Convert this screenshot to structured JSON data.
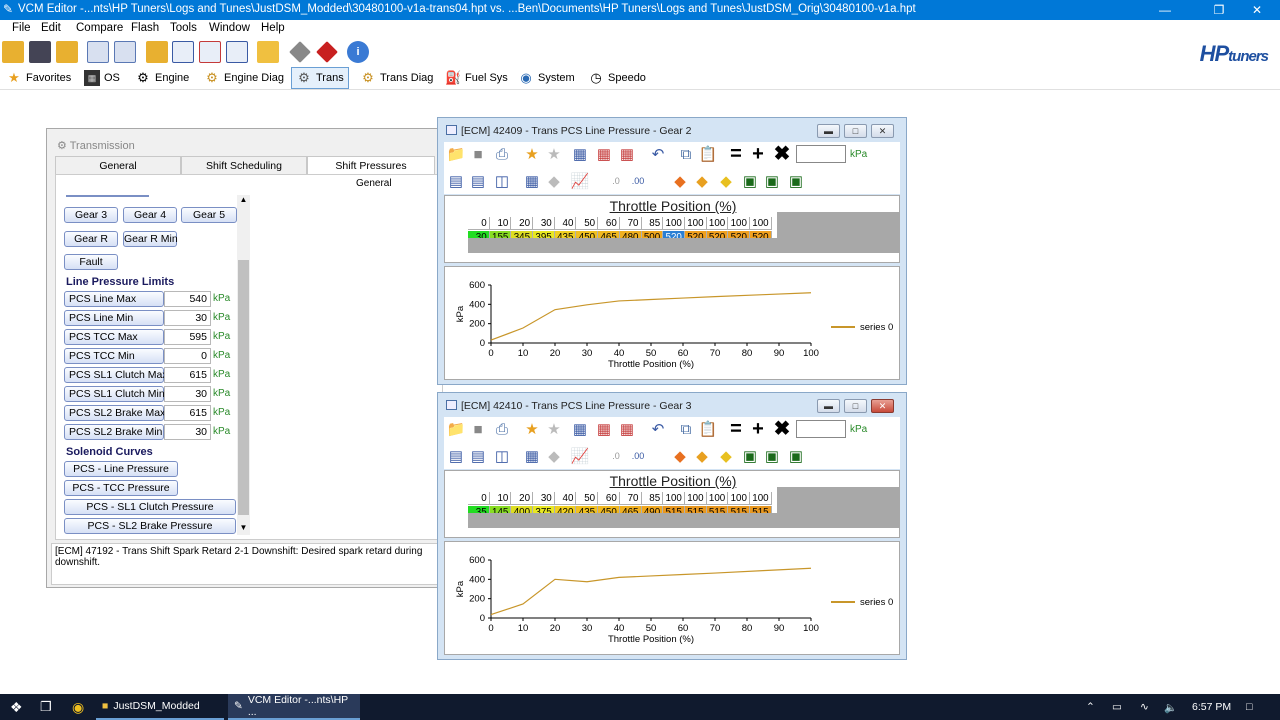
{
  "window": {
    "title": "VCM Editor -...nts\\HP Tuners\\Logs and Tunes\\JustDSM_Modded\\30480100-v1a-trans04.hpt vs. ...Ben\\Documents\\HP Tuners\\Logs and Tunes\\JustDSM_Orig\\30480100-v1a.hpt",
    "minimize": "—",
    "maximize": "❐",
    "close": "✕"
  },
  "menu": [
    "File",
    "Edit",
    "Compare",
    "Flash",
    "Tools",
    "Window",
    "Help"
  ],
  "logo": {
    "hp": "HP",
    "tuners": "tuners"
  },
  "nav_tabs": [
    {
      "label": "Favorites",
      "icon": "star-icon"
    },
    {
      "label": "OS",
      "icon": "chip-icon"
    },
    {
      "label": "Engine",
      "icon": "engine-icon"
    },
    {
      "label": "Engine Diag",
      "icon": "engine-diag-icon"
    },
    {
      "label": "Trans",
      "icon": "gear-icon"
    },
    {
      "label": "Trans Diag",
      "icon": "trans-diag-icon"
    },
    {
      "label": "Fuel Sys",
      "icon": "fuel-pump-icon"
    },
    {
      "label": "System",
      "icon": "system-icon"
    },
    {
      "label": "Speedo",
      "icon": "speedometer-icon"
    }
  ],
  "transmission": {
    "title": "Transmission",
    "tabs": [
      "General",
      "Shift Scheduling",
      "Shift Pressures"
    ],
    "active_tab": "Shift Pressures",
    "sub_header": "General",
    "gear_buttons": [
      "Gear 3",
      "Gear 4",
      "Gear 5",
      "Gear R",
      "Gear R Min",
      "Fault"
    ],
    "line_pressure_title": "Line Pressure Limits",
    "limits": [
      {
        "label": "PCS Line Max",
        "value": "540",
        "unit": "kPa"
      },
      {
        "label": "PCS Line Min",
        "value": "30",
        "unit": "kPa"
      },
      {
        "label": "PCS TCC Max",
        "value": "595",
        "unit": "kPa"
      },
      {
        "label": "PCS TCC Min",
        "value": "0",
        "unit": "kPa"
      },
      {
        "label": "PCS SL1 Clutch Max",
        "value": "615",
        "unit": "kPa"
      },
      {
        "label": "PCS SL1 Clutch Min",
        "value": "30",
        "unit": "kPa"
      },
      {
        "label": "PCS SL2 Brake Max",
        "value": "615",
        "unit": "kPa"
      },
      {
        "label": "PCS SL2 Brake Min",
        "value": "30",
        "unit": "kPa"
      }
    ],
    "solenoid_title": "Solenoid Curves",
    "solenoid_buttons": [
      "PCS - Line Pressure",
      "PCS - TCC Pressure",
      "PCS - SL1 Clutch Pressure",
      "PCS - SL2 Brake Pressure"
    ],
    "status": "[ECM] 47192 - Trans Shift Spark Retard 2-1 Downshift: Desired spark retard during downshift."
  },
  "gear2": {
    "title": "[ECM] 42409 - Trans PCS Line Pressure - Gear 2",
    "unit": "kPa",
    "table_header": "Throttle Position (%)",
    "x": [
      "0",
      "10",
      "20",
      "30",
      "40",
      "50",
      "60",
      "70",
      "85",
      "100",
      "100",
      "100",
      "100",
      "100"
    ],
    "y": [
      "30",
      "155",
      "345",
      "395",
      "435",
      "450",
      "465",
      "480",
      "500",
      "520",
      "520",
      "520",
      "520",
      "520"
    ],
    "colors": [
      "#22dd22",
      "#88dd22",
      "#dddd22",
      "#e8e822",
      "#f0d020",
      "#f0c020",
      "#f0b820",
      "#f0b020",
      "#f0a820",
      "#2a7fd4",
      "#f0a020",
      "#f0a020",
      "#f0a020",
      "#f0a020"
    ]
  },
  "gear3": {
    "title": "[ECM] 42410 - Trans PCS Line Pressure - Gear 3",
    "unit": "kPa",
    "table_header": "Throttle Position (%)",
    "x": [
      "0",
      "10",
      "20",
      "30",
      "40",
      "50",
      "60",
      "70",
      "85",
      "100",
      "100",
      "100",
      "100",
      "100"
    ],
    "y": [
      "35",
      "145",
      "400",
      "375",
      "420",
      "435",
      "450",
      "465",
      "490",
      "515",
      "515",
      "515",
      "515",
      "515"
    ],
    "colors": [
      "#22dd22",
      "#88dd22",
      "#dddd22",
      "#e8e822",
      "#f0d020",
      "#f0c020",
      "#f0b820",
      "#f0b020",
      "#f0a820",
      "#e89820",
      "#e89820",
      "#e89820",
      "#e89820",
      "#e89820"
    ]
  },
  "chart_data": [
    {
      "type": "line",
      "title": "",
      "xlabel": "Throttle Position (%)",
      "ylabel": "kPa",
      "xlim": [
        0,
        100
      ],
      "ylim": [
        0,
        600
      ],
      "xticks": [
        0,
        10,
        20,
        30,
        40,
        50,
        60,
        70,
        80,
        90,
        100
      ],
      "yticks": [
        0,
        200,
        400,
        600
      ],
      "legend": "right",
      "series": [
        {
          "name": "series 0",
          "color": "#c8962a",
          "x": [
            0,
            10,
            20,
            30,
            40,
            50,
            60,
            70,
            85,
            100
          ],
          "y": [
            30,
            155,
            345,
            395,
            435,
            450,
            465,
            480,
            500,
            520
          ]
        }
      ]
    },
    {
      "type": "line",
      "title": "",
      "xlabel": "Throttle Position (%)",
      "ylabel": "kPa",
      "xlim": [
        0,
        100
      ],
      "ylim": [
        0,
        600
      ],
      "xticks": [
        0,
        10,
        20,
        30,
        40,
        50,
        60,
        70,
        80,
        90,
        100
      ],
      "yticks": [
        0,
        200,
        400,
        600
      ],
      "legend": "right",
      "series": [
        {
          "name": "series 0",
          "color": "#c8962a",
          "x": [
            0,
            10,
            20,
            30,
            40,
            50,
            60,
            70,
            85,
            100
          ],
          "y": [
            35,
            145,
            400,
            375,
            420,
            435,
            450,
            465,
            490,
            515
          ]
        }
      ]
    }
  ],
  "taskbar": {
    "items": [
      "JustDSM_Modded",
      "VCM Editor -...nts\\HP ..."
    ],
    "time": "6:57 PM"
  }
}
